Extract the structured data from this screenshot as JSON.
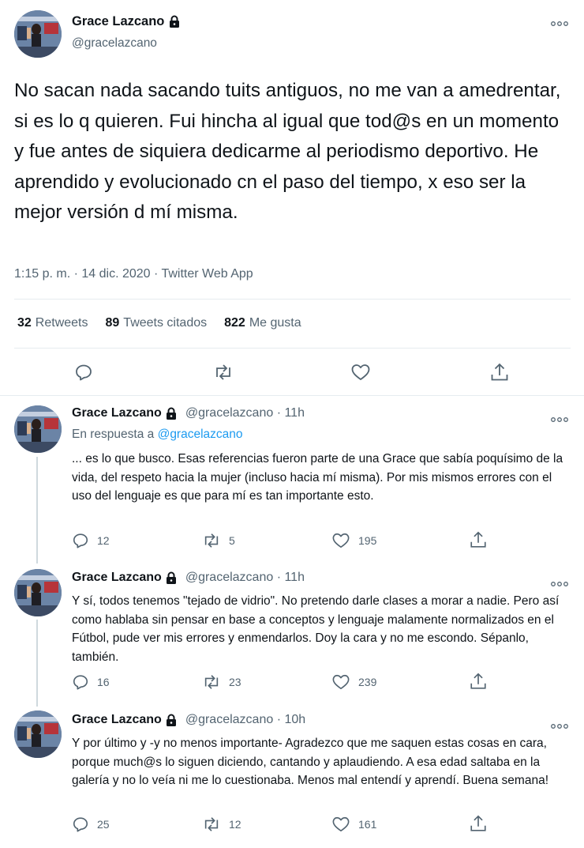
{
  "main_tweet": {
    "author_name": "Grace Lazcano",
    "author_handle": "@gracelazcano",
    "text": "No sacan nada sacando tuits antiguos, no me van a amedrentar, si es lo q quieren. Fui hincha al igual que tod@s en un momento y fue antes de siquiera dedicarme al periodismo deportivo. He aprendido y evolucionado cn el paso del tiempo, x eso ser la mejor versión d mí misma.",
    "meta": "1:15 p. m. · 14 dic. 2020 · Twitter Web App",
    "stats": {
      "retweets_count": "32",
      "retweets_label": "Retweets",
      "quotes_count": "89",
      "quotes_label": "Tweets citados",
      "likes_count": "822",
      "likes_label": "Me gusta"
    }
  },
  "replies": [
    {
      "author_name": "Grace Lazcano",
      "author_handle": "@gracelazcano · 11h",
      "in_reply_prefix": "En respuesta a",
      "in_reply_handle": "@gracelazcano",
      "text": "... es lo que busco. Esas referencias fueron parte de una Grace que sabía poquísimo de la vida, del respeto hacia la mujer (incluso hacia mí misma). Por mis mismos errores con el uso del lenguaje es que para mí es tan importante esto.",
      "replies_count": "12",
      "retweets_count": "5",
      "likes_count": "195"
    },
    {
      "author_name": "Grace Lazcano",
      "author_handle": "@gracelazcano · 11h",
      "text": "Y sí, todos tenemos \"tejado de vidrio\". No pretendo darle clases a morar a nadie. Pero así como hablaba sin pensar en base a conceptos y lenguaje malamente normalizados en el Fútbol, pude ver mis errores y enmendarlos. Doy la cara y no me escondo. Sépanlo, también.",
      "replies_count": "16",
      "retweets_count": "23",
      "likes_count": "239"
    },
    {
      "author_name": "Grace Lazcano",
      "author_handle": "@gracelazcano · 10h",
      "text": "Y por último y -y no menos importante- Agradezco que me saquen estas cosas en cara, porque much@s lo siguen diciendo, cantando y aplaudiendo. A esa edad saltaba en la galería y no lo veía ni me lo cuestionaba. Menos mal entendí y aprendí. Buena semana!",
      "replies_count": "25",
      "retweets_count": "12",
      "likes_count": "161"
    }
  ],
  "icons": {
    "lock": "lock-icon",
    "more": "more-icon",
    "reply": "reply-icon",
    "retweet": "retweet-icon",
    "like": "like-icon",
    "share": "share-icon"
  },
  "colors": {
    "text": "#0f1419",
    "secondary": "#536471",
    "link": "#1d9bf0",
    "divider": "#e6ecf0"
  }
}
